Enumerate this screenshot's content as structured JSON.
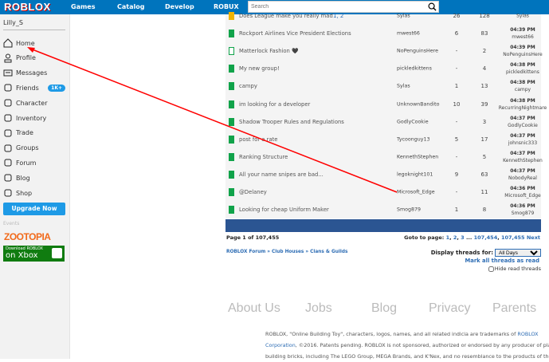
{
  "topbar": {
    "logo": "ROBLOX",
    "nav": [
      "Games",
      "Catalog",
      "Develop",
      "ROBUX"
    ],
    "search_placeholder": "Search"
  },
  "sidebar": {
    "username": "Lilly_S",
    "items": [
      {
        "label": "Home",
        "icon": "home-icon"
      },
      {
        "label": "Profile",
        "icon": "profile-icon"
      },
      {
        "label": "Messages",
        "icon": "messages-icon"
      },
      {
        "label": "Friends",
        "icon": "friends-icon",
        "badge": "1K+"
      },
      {
        "label": "Character",
        "icon": "character-icon"
      },
      {
        "label": "Inventory",
        "icon": "inventory-icon"
      },
      {
        "label": "Trade",
        "icon": "trade-icon"
      },
      {
        "label": "Groups",
        "icon": "groups-icon"
      },
      {
        "label": "Forum",
        "icon": "forum-icon"
      },
      {
        "label": "Blog",
        "icon": "blog-icon"
      },
      {
        "label": "Shop",
        "icon": "shop-icon"
      }
    ],
    "upgrade": "Upgrade Now",
    "events": "Events",
    "zootopia": "ZOOTOPIA",
    "xbox_line1": "Download ROBLOX",
    "xbox_line2": "on Xbox"
  },
  "threads": [
    {
      "title": "Does League make you really mad",
      "pages": "1, 2",
      "author": "Sylas",
      "replies": "26",
      "views": "128",
      "time": "",
      "last": "Sylas",
      "hot": true
    },
    {
      "title": "Rockport Airlines Vice President Elections",
      "pages": "",
      "author": "mwest66",
      "replies": "6",
      "views": "83",
      "time": "04:39 PM",
      "last": "mwest66"
    },
    {
      "title": "Matterlock Fashion 🖤",
      "pages": "",
      "author": "NoPenguinsHere",
      "replies": "-",
      "views": "2",
      "time": "04:39 PM",
      "last": "NoPenguinsHere",
      "locked": true
    },
    {
      "title": "My new group!",
      "pages": "",
      "author": "pickledkittens",
      "replies": "-",
      "views": "4",
      "time": "04:38 PM",
      "last": "pickledkittens"
    },
    {
      "title": "campy",
      "pages": "",
      "author": "Sylas",
      "replies": "1",
      "views": "13",
      "time": "04:38 PM",
      "last": "campy"
    },
    {
      "title": "im looking for a developer",
      "pages": "",
      "author": "UnknownBandito",
      "replies": "10",
      "views": "39",
      "time": "04:38 PM",
      "last": "RecurringNightmare"
    },
    {
      "title": "Shadow Trooper Rules and Regulations",
      "pages": "",
      "author": "GodlyCookie",
      "replies": "-",
      "views": "3",
      "time": "04:37 PM",
      "last": "GodlyCookie"
    },
    {
      "title": "post for a rate",
      "pages": "",
      "author": "Tycoonguy13",
      "replies": "5",
      "views": "17",
      "time": "04:37 PM",
      "last": "johnsnic333"
    },
    {
      "title": "Ranking Structure",
      "pages": "",
      "author": "KennethStephen",
      "replies": "-",
      "views": "5",
      "time": "04:37 PM",
      "last": "KennethStephen"
    },
    {
      "title": "All your name snipes are bad...",
      "pages": "",
      "author": "legoknight101",
      "replies": "9",
      "views": "63",
      "time": "04:37 PM",
      "last": "NobodyReal"
    },
    {
      "title": "@Delaney",
      "pages": "",
      "author": "Microsoft_Edge",
      "replies": "-",
      "views": "11",
      "time": "04:36 PM",
      "last": "Microsoft_Edge"
    },
    {
      "title": "Looking for cheap Uniform Maker",
      "pages": "",
      "author": "Smog879",
      "replies": "1",
      "views": "8",
      "time": "04:36 PM",
      "last": "Smog879"
    }
  ],
  "pager": {
    "info": "Page 1 of 107,455",
    "goto_label": "Goto to page:",
    "pages": [
      "1",
      "2",
      "3",
      "107,454",
      "107,455"
    ],
    "ellipsis": "...",
    "next": "Next"
  },
  "breadcrumb": [
    "ROBLOX Forum",
    "Club Houses",
    "Clans & Guilds"
  ],
  "display": {
    "label": "Display threads for:",
    "value": "All Days",
    "mark_all": "Mark all threads as read",
    "hide_read": "Hide read threads"
  },
  "footer": {
    "links": [
      "About Us",
      "Jobs",
      "Blog",
      "Privacy",
      "Parents"
    ],
    "legal1": "ROBLOX, \"Online Building Toy\", characters, logos, names, and all related indicia are trademarks of ",
    "legal_link1": "ROBLOX",
    "legal_link2": "Corporation",
    "legal2": ", ©2016. Patents pending. ROBLOX is not sponsored, authorized or endorsed by any producer of plastic",
    "legal3": "building bricks, including The LEGO Group, MEGA Brands, and K'Nex, and no resemblance to the products of these"
  },
  "colors": {
    "topbar": "#0074bd",
    "annotation": "#ff0000"
  }
}
